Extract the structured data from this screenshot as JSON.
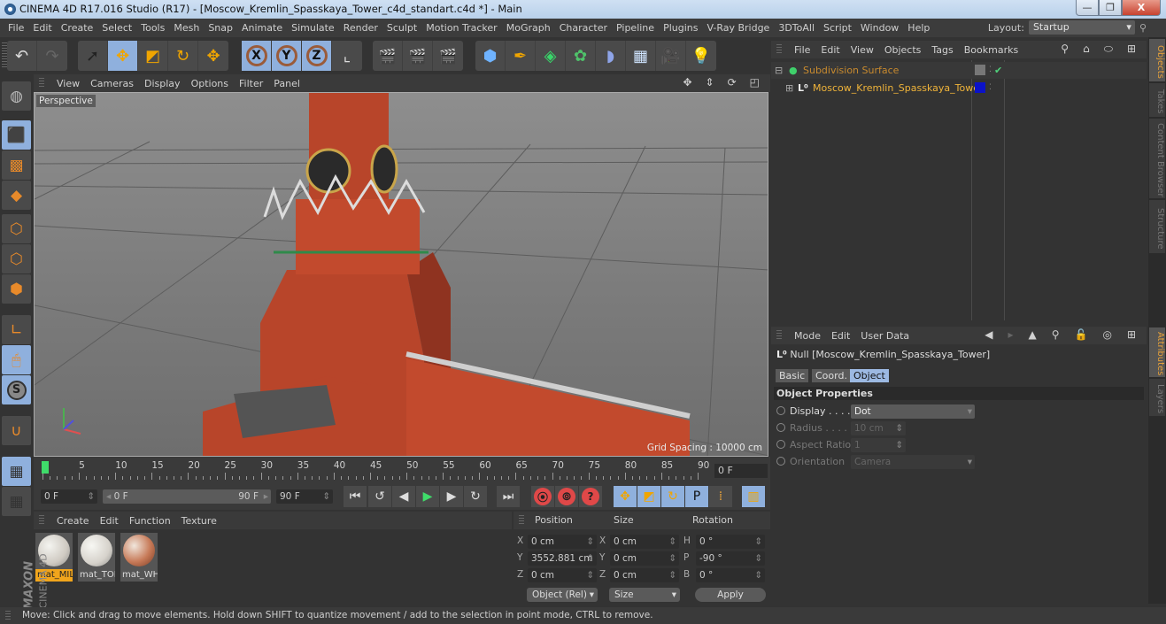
{
  "window": {
    "title": "CINEMA 4D R17.016 Studio (R17) - [Moscow_Kremlin_Spasskaya_Tower_c4d_standart.c4d *] - Main",
    "buttons": {
      "minimize": "—",
      "maximize": "❐",
      "close": "X"
    }
  },
  "menubar": {
    "items": [
      "File",
      "Edit",
      "Create",
      "Select",
      "Tools",
      "Mesh",
      "Snap",
      "Animate",
      "Simulate",
      "Render",
      "Sculpt",
      "Motion Tracker",
      "MoGraph",
      "Character",
      "Pipeline",
      "Plugins",
      "V-Ray Bridge",
      "3DToAll",
      "Script",
      "Window",
      "Help"
    ],
    "layout_label": "Layout:",
    "layout_value": "Startup"
  },
  "toolbar": {
    "history": [
      {
        "name": "undo-icon",
        "glyph": "↶"
      },
      {
        "name": "redo-icon",
        "glyph": "↷"
      }
    ],
    "tools": [
      {
        "name": "live-selection-icon",
        "glyph": "➚",
        "on": false
      },
      {
        "name": "move-icon",
        "glyph": "✥",
        "on": true
      },
      {
        "name": "scale-icon",
        "glyph": "◩",
        "on": false
      },
      {
        "name": "rotate-icon",
        "glyph": "↻",
        "on": false
      },
      {
        "name": "recent-tool-icon",
        "glyph": "✥",
        "on": false
      }
    ],
    "axes": [
      {
        "name": "x-axis-lock-icon",
        "glyph": "X"
      },
      {
        "name": "y-axis-lock-icon",
        "glyph": "Y"
      },
      {
        "name": "z-axis-lock-icon",
        "glyph": "Z"
      },
      {
        "name": "coordinate-system-icon",
        "glyph": "⌞"
      }
    ],
    "render": [
      {
        "name": "render-view-icon",
        "glyph": "🎬"
      },
      {
        "name": "render-picture-viewer-icon",
        "glyph": "🎬"
      },
      {
        "name": "render-settings-icon",
        "glyph": "🎬"
      }
    ],
    "create": [
      {
        "name": "cube-icon",
        "glyph": "⬢"
      },
      {
        "name": "pen-spline-icon",
        "glyph": "✒"
      },
      {
        "name": "subdivision-surface-icon",
        "glyph": "◈"
      },
      {
        "name": "cloner-icon",
        "glyph": "✿"
      },
      {
        "name": "deformer-icon",
        "glyph": "◗"
      },
      {
        "name": "floor-icon",
        "glyph": "▦"
      },
      {
        "name": "camera-icon",
        "glyph": "🎥"
      },
      {
        "name": "light-icon",
        "glyph": "💡"
      }
    ]
  },
  "left_tools": [
    {
      "name": "make-editable-icon",
      "glyph": "◍",
      "on": false
    },
    {
      "name": "model-mode-icon",
      "glyph": "⬛",
      "on": true
    },
    {
      "name": "texture-mode-icon",
      "glyph": "▩",
      "on": false
    },
    {
      "name": "workplane-mode-icon",
      "glyph": "◆",
      "on": false
    },
    {
      "name": "points-mode-icon",
      "glyph": "⬡",
      "on": false
    },
    {
      "name": "edges-mode-icon",
      "glyph": "⬡",
      "on": false
    },
    {
      "name": "polygons-mode-icon",
      "glyph": "⬢",
      "on": false
    },
    {
      "name": "axis-mode-icon",
      "glyph": "∟",
      "on": false
    },
    {
      "name": "tweak-mode-icon",
      "glyph": "🖱",
      "on": true
    },
    {
      "name": "solo-icon",
      "glyph": "S",
      "on": true
    },
    {
      "name": "snap-icon",
      "glyph": "∪",
      "on": false
    },
    {
      "name": "workplane-lock-icon",
      "glyph": "▦",
      "on": true
    },
    {
      "name": "workplane-align-icon",
      "glyph": "▦",
      "on": false
    }
  ],
  "viewport": {
    "menu": [
      "View",
      "Cameras",
      "Display",
      "Options",
      "Filter",
      "Panel"
    ],
    "camera_label": "Perspective",
    "grid_spacing": "Grid Spacing : 10000 cm",
    "nav_icons": [
      "move-view-icon",
      "zoom-view-icon",
      "rotate-view-icon",
      "maximize-view-icon"
    ]
  },
  "timeline": {
    "start": 0,
    "end": 90,
    "step": 5,
    "current_frame": 0,
    "current_frame_field": "0 F",
    "min_field": "0 F",
    "range_start": "0 F",
    "range_end": "90 F",
    "max_field": "90 F"
  },
  "transport": [
    {
      "name": "go-to-start-icon",
      "glyph": "⏮"
    },
    {
      "name": "previous-key-icon",
      "glyph": "↺"
    },
    {
      "name": "previous-frame-icon",
      "glyph": "◀"
    },
    {
      "name": "play-icon",
      "glyph": "▶"
    },
    {
      "name": "next-frame-icon",
      "glyph": "▶"
    },
    {
      "name": "next-key-icon",
      "glyph": "↻"
    },
    {
      "name": "go-to-end-icon",
      "glyph": "⏭"
    }
  ],
  "record": [
    {
      "name": "record-keys-icon",
      "glyph": "⦿"
    },
    {
      "name": "autokey-icon",
      "glyph": "⦾"
    },
    {
      "name": "keyframe-selection-icon",
      "glyph": "?"
    }
  ],
  "key_tracks": [
    {
      "name": "key-position-icon",
      "glyph": "✥",
      "on": true
    },
    {
      "name": "key-scale-icon",
      "glyph": "◩",
      "on": true
    },
    {
      "name": "key-rotation-icon",
      "glyph": "↻",
      "on": true
    },
    {
      "name": "key-parameter-icon",
      "glyph": "P",
      "on": true
    },
    {
      "name": "key-pla-icon",
      "glyph": "⁞",
      "on": false
    },
    {
      "name": "timeline-window-icon",
      "glyph": "▥",
      "on": true
    }
  ],
  "materials": {
    "menu": [
      "Create",
      "Edit",
      "Function",
      "Texture"
    ],
    "items": [
      {
        "label": "mat_MIL",
        "selected": true
      },
      {
        "label": "mat_TOI",
        "selected": false
      },
      {
        "label": "mat_WH",
        "selected": false
      }
    ]
  },
  "brand": {
    "line1": "MAXON",
    "line2": "CINEMA 4D"
  },
  "coordinates": {
    "headers": {
      "position": "Position",
      "size": "Size",
      "rotation": "Rotation"
    },
    "rows": [
      {
        "pl": "X",
        "pv": "0 cm",
        "sl": "X",
        "sv": "0 cm",
        "rl": "H",
        "rv": "0 °"
      },
      {
        "pl": "Y",
        "pv": "3552.881 cm",
        "sl": "Y",
        "sv": "0 cm",
        "rl": "P",
        "rv": "-90 °"
      },
      {
        "pl": "Z",
        "pv": "0 cm",
        "sl": "Z",
        "sv": "0 cm",
        "rl": "B",
        "rv": "0 °"
      }
    ],
    "mode_dropdown": "Object (Rel)",
    "size_dropdown": "Size",
    "apply": "Apply"
  },
  "objects": {
    "menu": [
      "File",
      "Edit",
      "View",
      "Objects",
      "Tags",
      "Bookmarks"
    ],
    "items": [
      {
        "name": "Subdivision Surface",
        "color": "#c88a2e"
      },
      {
        "name": "Moscow_Kremlin_Spasskaya_Tower",
        "color": "#f0b43a"
      }
    ]
  },
  "attributes": {
    "menu": [
      "Mode",
      "Edit",
      "User Data"
    ],
    "object_title": "Null [Moscow_Kremlin_Spasskaya_Tower]",
    "tabs": [
      "Basic",
      "Coord.",
      "Object"
    ],
    "active_tab": "Object",
    "section": "Object Properties",
    "props": [
      {
        "label": "Display . . . .",
        "value": "Dot",
        "enabled": true,
        "type": "dropdown"
      },
      {
        "label": "Radius . . . .",
        "value": "10 cm",
        "enabled": false,
        "type": "number"
      },
      {
        "label": "Aspect Ratio",
        "value": "1",
        "enabled": false,
        "type": "number"
      },
      {
        "label": "Orientation",
        "value": "Camera",
        "enabled": false,
        "type": "dropdown"
      }
    ]
  },
  "side_tabs": [
    "Objects",
    "Takes",
    "Content Browser",
    "Structure",
    "Attributes",
    "Layers"
  ],
  "status": "Move: Click and drag to move elements. Hold down SHIFT to quantize movement / add to the selection in point mode, CTRL to remove."
}
